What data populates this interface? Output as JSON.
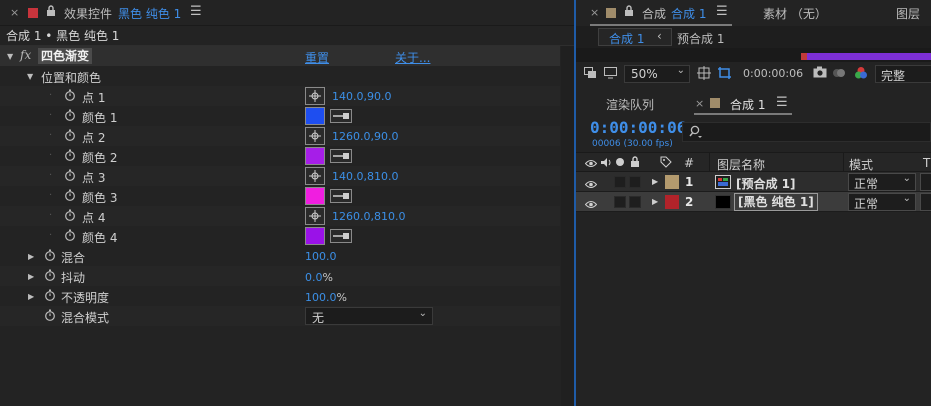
{
  "left_panel": {
    "tab": {
      "close": "×",
      "title": "效果控件",
      "layer_name": "黑色 纯色 1",
      "menu": "☰",
      "chip_color": "#c8343c"
    },
    "breadcrumb": "合成 1 • 黑色 纯色 1",
    "effect": {
      "fx": "fx",
      "name": "四色渐变",
      "reset": "重置",
      "about": "关于..."
    },
    "group": "位置和颜色",
    "properties": [
      {
        "label": "点 1",
        "kind": "point",
        "value": "140.0,90.0"
      },
      {
        "label": "颜色 1",
        "kind": "color",
        "color": "#1e4ef0"
      },
      {
        "label": "点 2",
        "kind": "point",
        "value": "1260.0,90.0"
      },
      {
        "label": "颜色 2",
        "kind": "color",
        "color": "#a61ee8"
      },
      {
        "label": "点 3",
        "kind": "point",
        "value": "140.0,810.0"
      },
      {
        "label": "颜色 3",
        "kind": "color",
        "color": "#f01ee0"
      },
      {
        "label": "点 4",
        "kind": "point",
        "value": "1260.0,810.0"
      },
      {
        "label": "颜色 4",
        "kind": "color",
        "color": "#9a12e8"
      }
    ],
    "blend": {
      "label": "混合",
      "value": "100.0"
    },
    "jitter": {
      "label": "抖动",
      "value": "0.0",
      "unit": "%"
    },
    "opacity": {
      "label": "不透明度",
      "value": "100.0",
      "unit": "%"
    },
    "blend_mode": {
      "label": "混合模式",
      "value": "无"
    }
  },
  "right_panel": {
    "comp_tab": {
      "close": "×",
      "prefix": "合成",
      "name": "合成 1",
      "menu": "☰",
      "chip_color": "#a08c6a"
    },
    "footage_tab": "素材 （无）",
    "layer_tab": "图层",
    "flow": {
      "current": "合成 1",
      "arrow": "‹",
      "other": "预合成 1"
    },
    "toolbar": {
      "zoom": "50%",
      "timecode": "0:00:00:06",
      "quality": "完整"
    },
    "timeline_tabs": {
      "render_queue": "渲染队列",
      "close": "×",
      "comp": "合成 1",
      "menu": "☰"
    },
    "timecode": "0:00:00:06",
    "frame_info": "00006 (30.00 fps)",
    "search_placeholder": "",
    "columns": {
      "hash": "#",
      "name": "图层名称",
      "mode": "模式",
      "t": "T"
    },
    "layers": [
      {
        "num": "1",
        "name": "[预合成 1]",
        "mode": "正常",
        "label_color": "#b39a6e"
      },
      {
        "num": "2",
        "name": "[黑色 纯色 1]",
        "mode": "正常",
        "label_color": "#b2232a"
      }
    ]
  }
}
